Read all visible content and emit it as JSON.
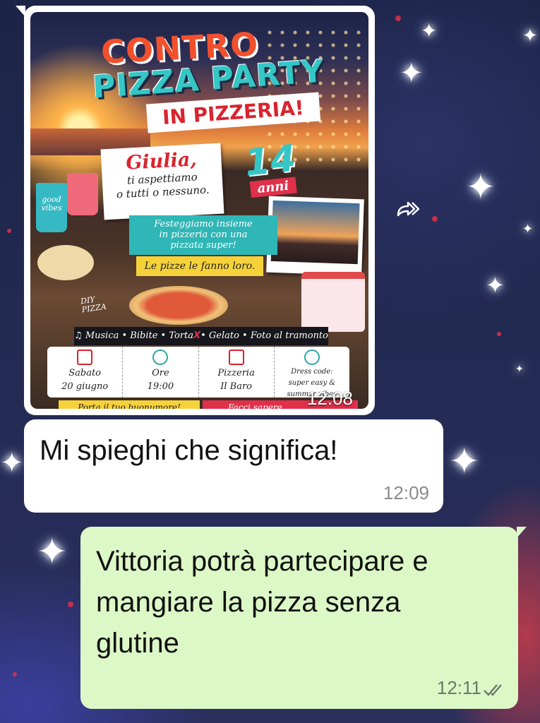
{
  "chat": {
    "image_message": {
      "time": "12:08",
      "poster": {
        "title_line1": "CONTRO",
        "title_line2": "PIZZA PARTY",
        "subtitle": "IN PIZZERIA!",
        "guest_name": "Giulia,",
        "invite_line1": "ti aspettiamo",
        "invite_line2": "o tutti o nessuno.",
        "age_number": "14",
        "age_label": "anni",
        "celebrate_line1": "Festeggiamo insieme",
        "celebrate_line2": "in pizzeria con una",
        "celebrate_line3": "pizzata super!",
        "pizzas_note": "Le pizze le fanno loro.",
        "cup_label_line1": "good",
        "cup_label_line2": "vibes",
        "diy_line1": "DIY",
        "diy_line2": "PIZZA",
        "activities_part1": "Musica • Bibite • Torta",
        "activities_x": "X",
        "activities_part2": "• Gelato • Foto al tramonto",
        "date_line1": "Sabato",
        "date_line2": "20 giugno",
        "time_line1": "Ore",
        "time_line2": "19:00",
        "place_line1": "Pizzeria",
        "place_line2": "Il Baro",
        "dress_line1": "Dress code:",
        "dress_line2": "super easy &",
        "dress_line3": "summer vibes",
        "footer_left": "Porta il tuo buonumore!",
        "footer_right": "Facci sapere"
      }
    },
    "incoming_message": {
      "text": "Mi spieghi che significa!",
      "time": "12:09"
    },
    "outgoing_message": {
      "text": "Vittoria potrà partecipare e mangiare la pizza senza glutine",
      "time": "12:11",
      "status": "read"
    },
    "forward_icon": "forward-arrow-icon"
  },
  "colors": {
    "outgoing_bubble": "#dcf8c6",
    "incoming_bubble": "#ffffff",
    "read_ticks": "#6b7a6b",
    "wallpaper": "#1c2447"
  }
}
